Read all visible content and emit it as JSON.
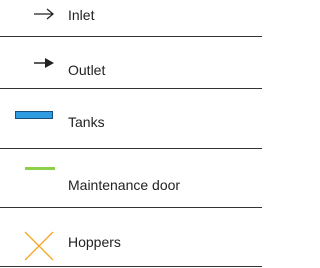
{
  "legend": {
    "items": [
      {
        "label": "Inlet",
        "icon": "arrow-right-outline-icon"
      },
      {
        "label": "Outlet",
        "icon": "arrow-right-filled-icon"
      },
      {
        "label": "Tanks",
        "icon": "blue-bar-icon"
      },
      {
        "label": "Maintenance door",
        "icon": "green-line-icon"
      },
      {
        "label": "Hoppers",
        "icon": "orange-cross-icon"
      }
    ]
  },
  "colors": {
    "tanks": "#2f9be0",
    "tanks_outline": "#1a4f7a",
    "maintenance_door": "#8dd14a",
    "hoppers": "#f5a623",
    "divider": "#333333",
    "text": "#222222"
  }
}
